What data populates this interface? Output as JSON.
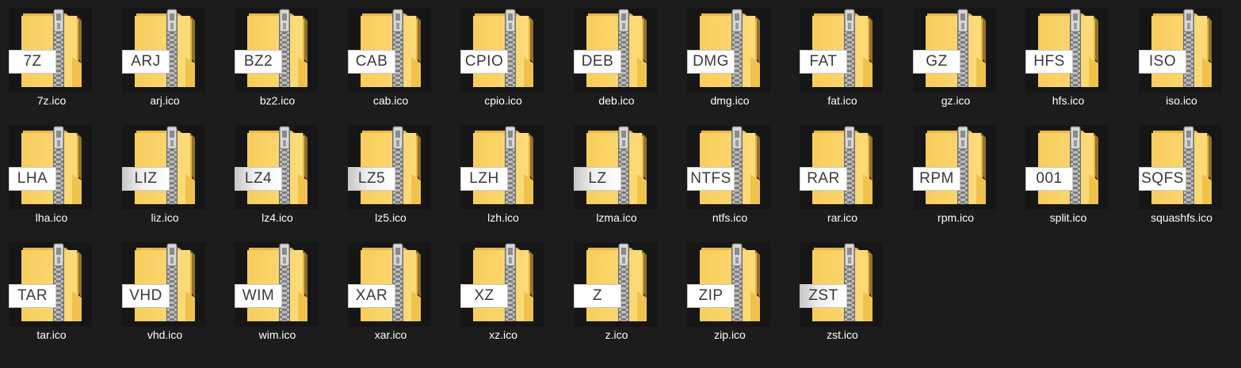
{
  "files": [
    {
      "name": "7z.ico",
      "badge": "7Z"
    },
    {
      "name": "arj.ico",
      "badge": "ARJ"
    },
    {
      "name": "bz2.ico",
      "badge": "BZ2"
    },
    {
      "name": "cab.ico",
      "badge": "CAB"
    },
    {
      "name": "cpio.ico",
      "badge": "CPIO"
    },
    {
      "name": "deb.ico",
      "badge": "DEB"
    },
    {
      "name": "dmg.ico",
      "badge": "DMG"
    },
    {
      "name": "fat.ico",
      "badge": "FAT"
    },
    {
      "name": "gz.ico",
      "badge": "GZ"
    },
    {
      "name": "hfs.ico",
      "badge": "HFS"
    },
    {
      "name": "iso.ico",
      "badge": "ISO"
    },
    {
      "name": "lha.ico",
      "badge": "LHA"
    },
    {
      "name": "liz.ico",
      "badge": "LIZ",
      "faded": true
    },
    {
      "name": "lz4.ico",
      "badge": "LZ4",
      "faded": true
    },
    {
      "name": "lz5.ico",
      "badge": "LZ5",
      "faded": true
    },
    {
      "name": "lzh.ico",
      "badge": "LZH"
    },
    {
      "name": "lzma.ico",
      "badge": "LZ",
      "faded": true
    },
    {
      "name": "ntfs.ico",
      "badge": "NTFS"
    },
    {
      "name": "rar.ico",
      "badge": "RAR"
    },
    {
      "name": "rpm.ico",
      "badge": "RPM"
    },
    {
      "name": "split.ico",
      "badge": "001"
    },
    {
      "name": "squashfs.ico",
      "badge": "SQFS"
    },
    {
      "name": "tar.ico",
      "badge": "TAR"
    },
    {
      "name": "vhd.ico",
      "badge": "VHD"
    },
    {
      "name": "wim.ico",
      "badge": "WIM"
    },
    {
      "name": "xar.ico",
      "badge": "XAR"
    },
    {
      "name": "xz.ico",
      "badge": "XZ"
    },
    {
      "name": "z.ico",
      "badge": "Z"
    },
    {
      "name": "zip.ico",
      "badge": "ZIP"
    },
    {
      "name": "zst.ico",
      "badge": "ZST",
      "faded": true
    }
  ],
  "colors": {
    "background": "#1c1c1c",
    "folder_light": "#fbd56e",
    "folder_dark": "#e8b83e",
    "zipper": "#9c9c9c",
    "label_text": "#ffffff"
  },
  "icon": "zipped-folder-icon"
}
